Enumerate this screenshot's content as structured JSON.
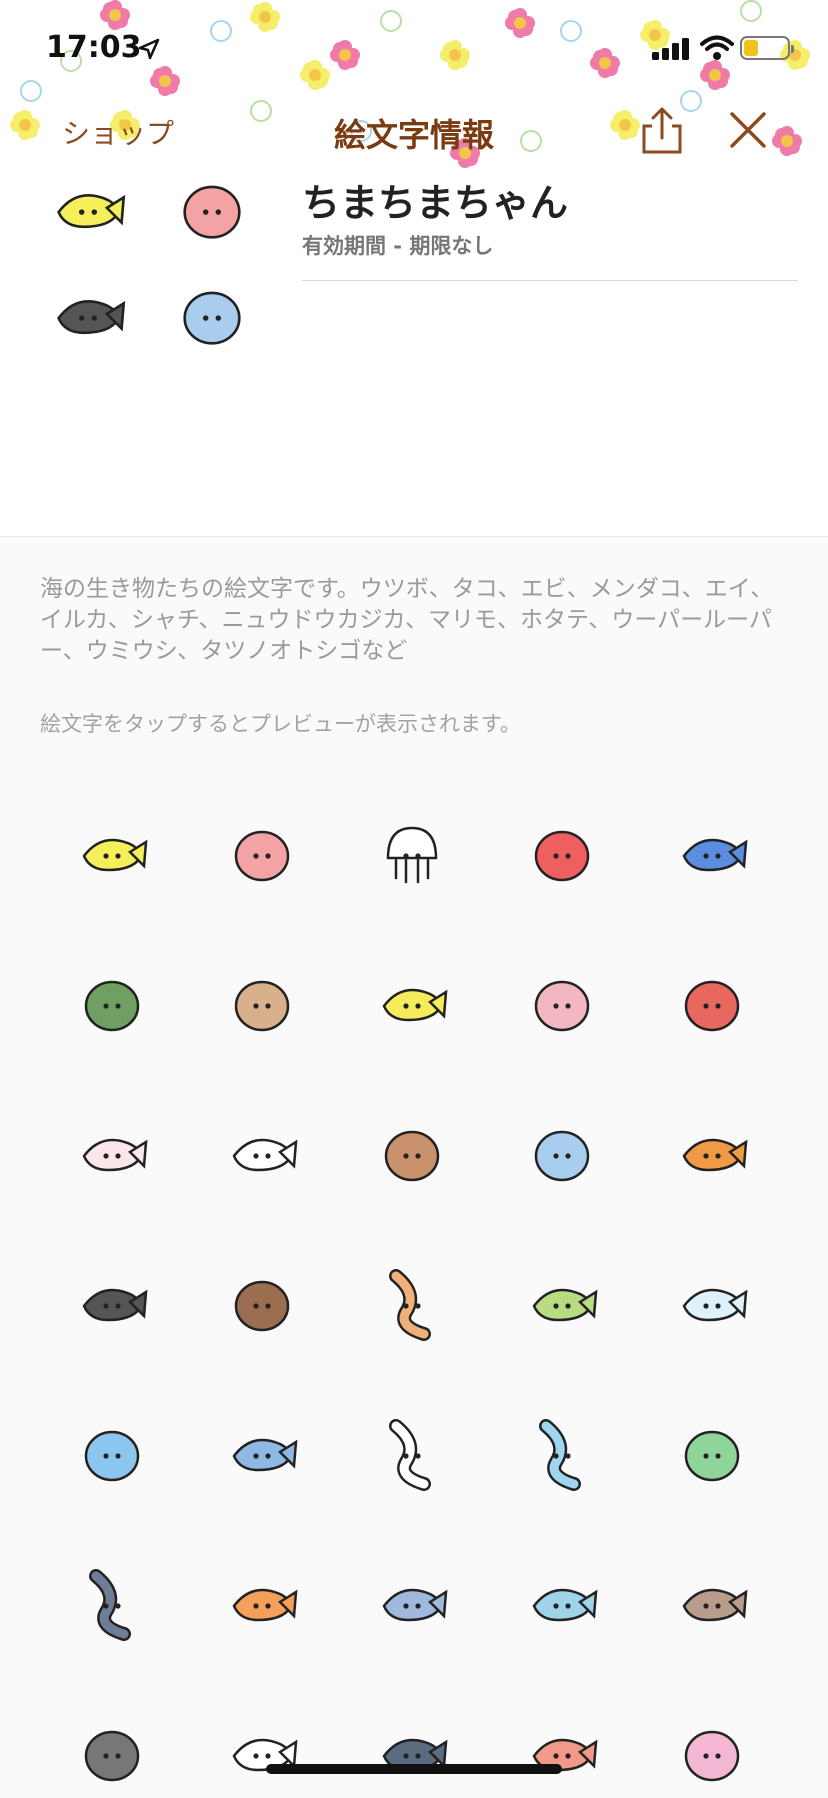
{
  "status_bar": {
    "time": "17:03"
  },
  "nav": {
    "back_label": "ショップ",
    "title": "絵文字情報"
  },
  "product": {
    "name": "ちまちまちゃん",
    "validity": "有効期間 - 期限なし"
  },
  "description": "海の生き物たちの絵文字です。ウツボ、タコ、エビ、メンダコ、エイ、イルカ、シャチ、ニュウドウカジカ、マリモ、ホタテ、ウーパールーパー、ウミウシ、タツノオトシゴなど",
  "hint": "絵文字をタップするとプレビューが表示されます。",
  "colors": {
    "nav_text": "#8b4b20",
    "title_text": "#7a3b10",
    "background": "#fafafa"
  },
  "preview_thumbs": [
    {
      "name": "yellow-fish-icon",
      "fill": "#f4ef5a"
    },
    {
      "name": "shrimp-icon",
      "fill": "#f3a3a3"
    },
    {
      "name": "orca-icon",
      "fill": "#555555"
    },
    {
      "name": "sea-slug-icon",
      "fill": "#a9cdee"
    }
  ],
  "emoji_grid": [
    {
      "name": "yellow-fish-icon",
      "fill": "#f4ef5a"
    },
    {
      "name": "shrimp-icon",
      "fill": "#f3a3a3"
    },
    {
      "name": "squid-icon",
      "fill": "#ffffff"
    },
    {
      "name": "octopus-icon",
      "fill": "#ef5f5f"
    },
    {
      "name": "whale-shark-icon",
      "fill": "#5b8ee0"
    },
    {
      "name": "marimo-icon",
      "fill": "#6fa062"
    },
    {
      "name": "scallop-icon",
      "fill": "#d9b08c"
    },
    {
      "name": "striped-fish-icon",
      "fill": "#f4ec5a"
    },
    {
      "name": "axolotl-icon",
      "fill": "#f3b7c2"
    },
    {
      "name": "dumbo-octopus-icon",
      "fill": "#e8675f"
    },
    {
      "name": "ghost-fish-icon",
      "fill": "#fbe7ea"
    },
    {
      "name": "fish-bone-icon",
      "fill": "#ffffff"
    },
    {
      "name": "clam-icon",
      "fill": "#c9916c"
    },
    {
      "name": "sea-slug-icon",
      "fill": "#a9cdee"
    },
    {
      "name": "starfish-icon",
      "fill": "#f19a45"
    },
    {
      "name": "orca-icon",
      "fill": "#555555"
    },
    {
      "name": "sea-urchin-icon",
      "fill": "#9b6e51"
    },
    {
      "name": "seahorse-icon",
      "fill": "#f0b07a"
    },
    {
      "name": "leaf-fish-icon",
      "fill": "#b7dc82"
    },
    {
      "name": "jellyfish-icon",
      "fill": "#dff2fb"
    },
    {
      "name": "whale-icon",
      "fill": "#8cc6ef"
    },
    {
      "name": "sunfish-icon",
      "fill": "#8fb9e4"
    },
    {
      "name": "spotted-eel-icon",
      "fill": "#ffffff"
    },
    {
      "name": "ribbon-eel-icon",
      "fill": "#9fd6ee"
    },
    {
      "name": "turtle-icon",
      "fill": "#8fd59b"
    },
    {
      "name": "eel-icon",
      "fill": "#6d7d95"
    },
    {
      "name": "clownfish-icon",
      "fill": "#f5a05a"
    },
    {
      "name": "oarfish-icon",
      "fill": "#9fb8db"
    },
    {
      "name": "dolphin-icon",
      "fill": "#9fd3ea"
    },
    {
      "name": "shark-icon",
      "fill": "#b89c8c"
    },
    {
      "name": "stingray-icon",
      "fill": "#777777"
    },
    {
      "name": "flatfish-icon",
      "fill": "#ffffff"
    },
    {
      "name": "anglerfish-icon",
      "fill": "#5b6b80"
    },
    {
      "name": "blobfish-icon",
      "fill": "#f19a8a"
    },
    {
      "name": "dumbo-pink-icon",
      "fill": "#f3b7d4"
    }
  ]
}
